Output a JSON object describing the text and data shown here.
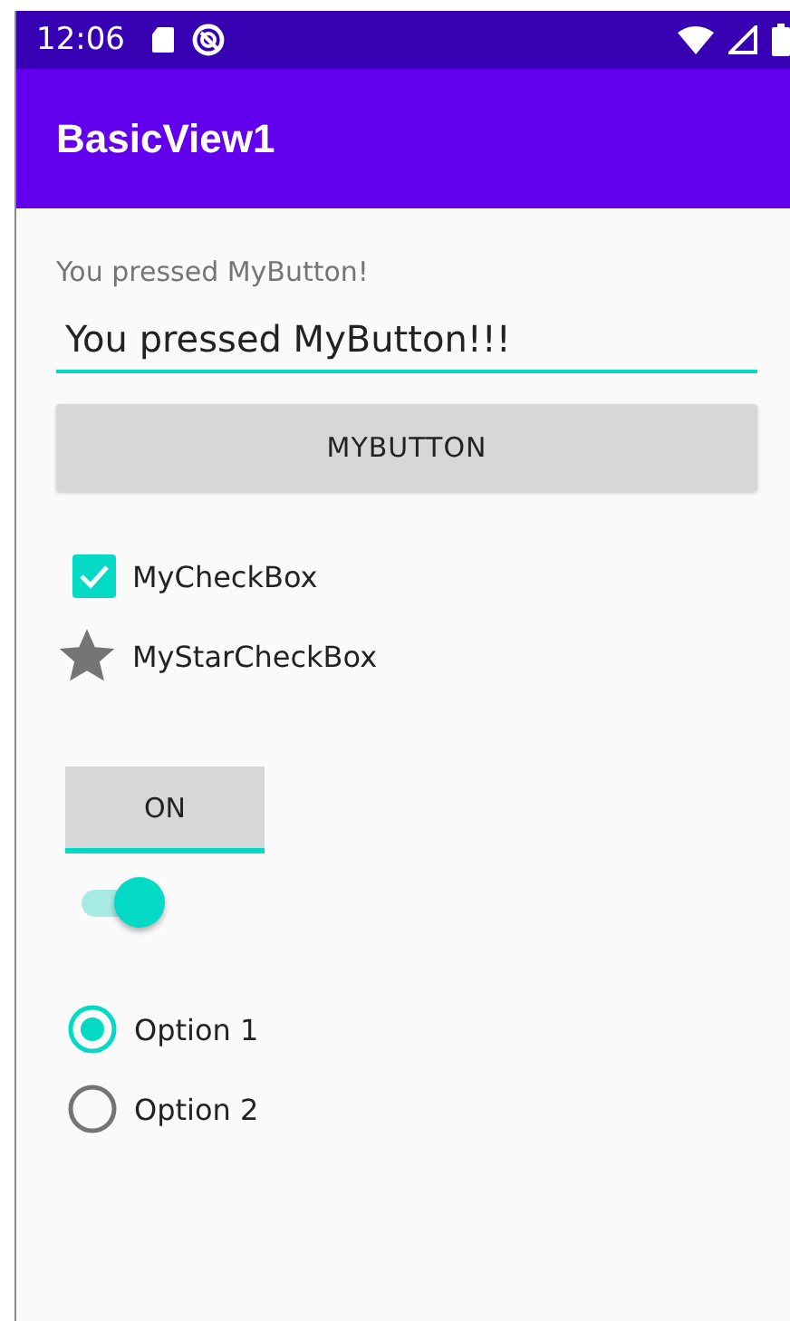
{
  "status_bar": {
    "time": "12:06"
  },
  "app_bar": {
    "title": "BasicView1"
  },
  "message": "You pressed MyButton!",
  "text_field": {
    "value": "You pressed MyButton!!!"
  },
  "button": {
    "label": "MYBUTTON"
  },
  "checkboxes": [
    {
      "kind": "box",
      "label": "MyCheckBox",
      "checked": true
    },
    {
      "kind": "star",
      "label": "MyStarCheckBox",
      "checked": false
    }
  ],
  "toggle_button": {
    "label": "ON",
    "checked": true
  },
  "switch": {
    "on": true
  },
  "radios": [
    {
      "label": "Option 1",
      "selected": true
    },
    {
      "label": "Option 2",
      "selected": false
    }
  ]
}
